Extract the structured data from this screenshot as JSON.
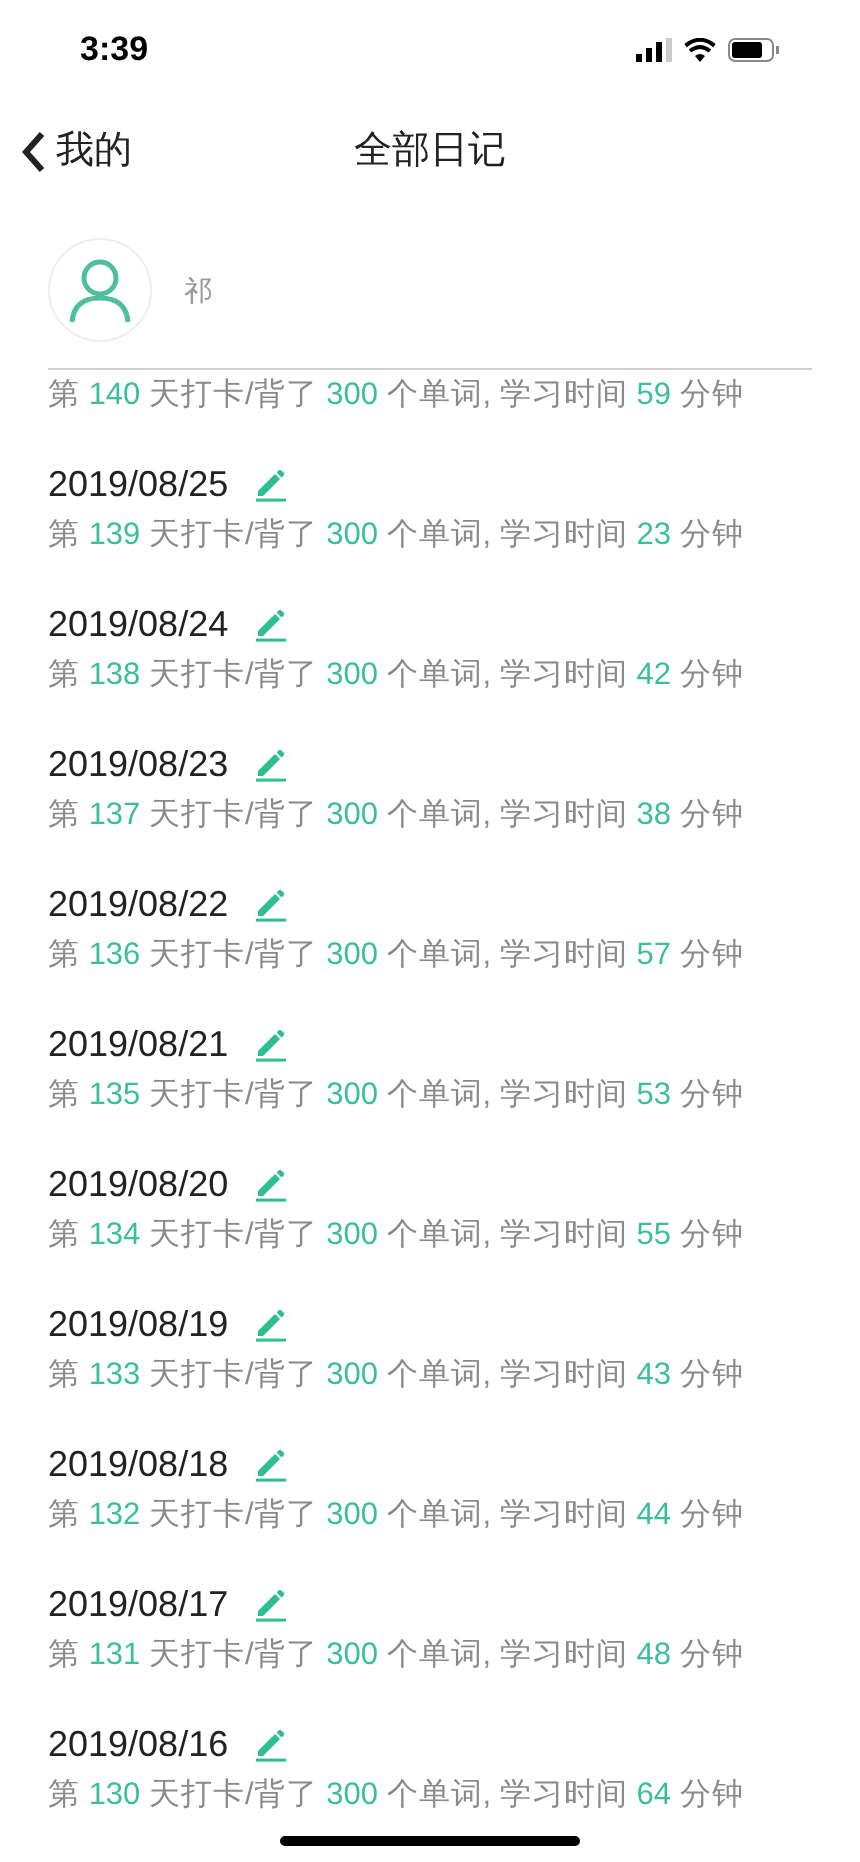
{
  "status_bar": {
    "time": "3:39"
  },
  "nav": {
    "back": "我的",
    "title": "全部日记"
  },
  "profile": {
    "name": "祁"
  },
  "entries": [
    {
      "summary": [
        {
          "text": "第 ",
          "kind": "text"
        },
        {
          "text": "140",
          "kind": "number"
        },
        {
          "text": " 天打卡/背了 ",
          "kind": "text"
        },
        {
          "text": "300",
          "kind": "number"
        },
        {
          "text": " 个单词, 学习时间 ",
          "kind": "text"
        },
        {
          "text": "59",
          "kind": "number"
        },
        {
          "text": " 分钟",
          "kind": "text"
        }
      ]
    },
    {
      "date": "2019/08/25",
      "summary": [
        {
          "text": "第 ",
          "kind": "text"
        },
        {
          "text": "139",
          "kind": "number"
        },
        {
          "text": " 天打卡/背了 ",
          "kind": "text"
        },
        {
          "text": "300",
          "kind": "number"
        },
        {
          "text": " 个单词, 学习时间 ",
          "kind": "text"
        },
        {
          "text": "23",
          "kind": "number"
        },
        {
          "text": " 分钟",
          "kind": "text"
        }
      ]
    },
    {
      "date": "2019/08/24",
      "summary": [
        {
          "text": "第 ",
          "kind": "text"
        },
        {
          "text": "138",
          "kind": "number"
        },
        {
          "text": " 天打卡/背了 ",
          "kind": "text"
        },
        {
          "text": "300",
          "kind": "number"
        },
        {
          "text": " 个单词, 学习时间 ",
          "kind": "text"
        },
        {
          "text": "42",
          "kind": "number"
        },
        {
          "text": " 分钟",
          "kind": "text"
        }
      ]
    },
    {
      "date": "2019/08/23",
      "summary": [
        {
          "text": "第 ",
          "kind": "text"
        },
        {
          "text": "137",
          "kind": "number"
        },
        {
          "text": " 天打卡/背了 ",
          "kind": "text"
        },
        {
          "text": "300",
          "kind": "number"
        },
        {
          "text": " 个单词, 学习时间 ",
          "kind": "text"
        },
        {
          "text": "38",
          "kind": "number"
        },
        {
          "text": " 分钟",
          "kind": "text"
        }
      ]
    },
    {
      "date": "2019/08/22",
      "summary": [
        {
          "text": "第 ",
          "kind": "text"
        },
        {
          "text": "136",
          "kind": "number"
        },
        {
          "text": " 天打卡/背了 ",
          "kind": "text"
        },
        {
          "text": "300",
          "kind": "number"
        },
        {
          "text": " 个单词, 学习时间 ",
          "kind": "text"
        },
        {
          "text": "57",
          "kind": "number"
        },
        {
          "text": " 分钟",
          "kind": "text"
        }
      ]
    },
    {
      "date": "2019/08/21",
      "summary": [
        {
          "text": "第 ",
          "kind": "text"
        },
        {
          "text": "135",
          "kind": "number"
        },
        {
          "text": " 天打卡/背了 ",
          "kind": "text"
        },
        {
          "text": "300",
          "kind": "number"
        },
        {
          "text": " 个单词, 学习时间 ",
          "kind": "text"
        },
        {
          "text": "53",
          "kind": "number"
        },
        {
          "text": " 分钟",
          "kind": "text"
        }
      ]
    },
    {
      "date": "2019/08/20",
      "summary": [
        {
          "text": "第 ",
          "kind": "text"
        },
        {
          "text": "134",
          "kind": "number"
        },
        {
          "text": " 天打卡/背了 ",
          "kind": "text"
        },
        {
          "text": "300",
          "kind": "number"
        },
        {
          "text": " 个单词, 学习时间 ",
          "kind": "text"
        },
        {
          "text": "55",
          "kind": "number"
        },
        {
          "text": " 分钟",
          "kind": "text"
        }
      ]
    },
    {
      "date": "2019/08/19",
      "summary": [
        {
          "text": "第 ",
          "kind": "text"
        },
        {
          "text": "133",
          "kind": "number"
        },
        {
          "text": " 天打卡/背了 ",
          "kind": "text"
        },
        {
          "text": "300",
          "kind": "number"
        },
        {
          "text": " 个单词, 学习时间 ",
          "kind": "text"
        },
        {
          "text": "43",
          "kind": "number"
        },
        {
          "text": " 分钟",
          "kind": "text"
        }
      ]
    },
    {
      "date": "2019/08/18",
      "summary": [
        {
          "text": "第 ",
          "kind": "text"
        },
        {
          "text": "132",
          "kind": "number"
        },
        {
          "text": " 天打卡/背了 ",
          "kind": "text"
        },
        {
          "text": "300",
          "kind": "number"
        },
        {
          "text": " 个单词, 学习时间 ",
          "kind": "text"
        },
        {
          "text": "44",
          "kind": "number"
        },
        {
          "text": " 分钟",
          "kind": "text"
        }
      ]
    },
    {
      "date": "2019/08/17",
      "summary": [
        {
          "text": "第 ",
          "kind": "text"
        },
        {
          "text": "131",
          "kind": "number"
        },
        {
          "text": " 天打卡/背了 ",
          "kind": "text"
        },
        {
          "text": "300",
          "kind": "number"
        },
        {
          "text": " 个单词, 学习时间 ",
          "kind": "text"
        },
        {
          "text": "48",
          "kind": "number"
        },
        {
          "text": " 分钟",
          "kind": "text"
        }
      ]
    },
    {
      "date": "2019/08/16",
      "summary": [
        {
          "text": "第 ",
          "kind": "text"
        },
        {
          "text": "130",
          "kind": "number"
        },
        {
          "text": " 天打卡/背了 ",
          "kind": "text"
        },
        {
          "text": "300",
          "kind": "number"
        },
        {
          "text": " 个单词, 学习时间 ",
          "kind": "text"
        },
        {
          "text": "64",
          "kind": "number"
        },
        {
          "text": " 分钟",
          "kind": "text"
        }
      ]
    }
  ]
}
